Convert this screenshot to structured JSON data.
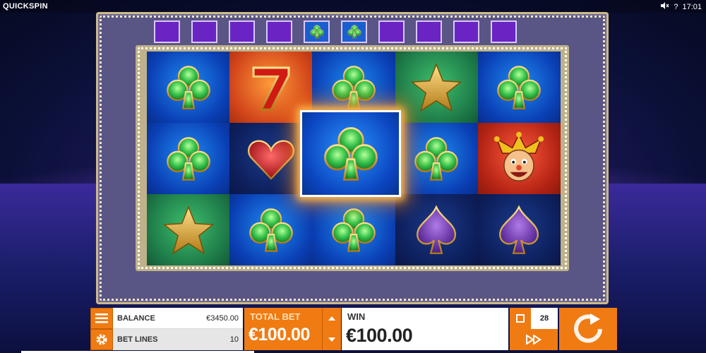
{
  "header": {
    "brand": "QUICKSPIN",
    "sound_icon": "speaker-mute-icon",
    "help_label": "?",
    "clock": "17:01"
  },
  "colors": {
    "accent": "#f07b12",
    "line_marker": "#6a24c4",
    "line_marker_hit": "#1a5fd0"
  },
  "line_markers": [
    {
      "state": "empty"
    },
    {
      "state": "empty"
    },
    {
      "state": "empty"
    },
    {
      "state": "empty"
    },
    {
      "state": "club"
    },
    {
      "state": "club"
    },
    {
      "state": "empty"
    },
    {
      "state": "empty"
    },
    {
      "state": "empty"
    },
    {
      "state": "empty"
    }
  ],
  "reels": [
    [
      "club",
      "seven",
      "club",
      "star",
      "club"
    ],
    [
      "club",
      "heart",
      "club",
      "club",
      "jester"
    ],
    [
      "star",
      "club",
      "club",
      "spade",
      "spade"
    ]
  ],
  "controls": {
    "balance_label": "BALANCE",
    "balance_value": "€3450.00",
    "bet_lines_label": "BET LINES",
    "bet_lines_value": "10",
    "total_bet_label": "TOTAL BET",
    "total_bet_value": "€100.00",
    "win_label": "WIN",
    "win_value": "€100.00",
    "autoplay_count": "28"
  }
}
